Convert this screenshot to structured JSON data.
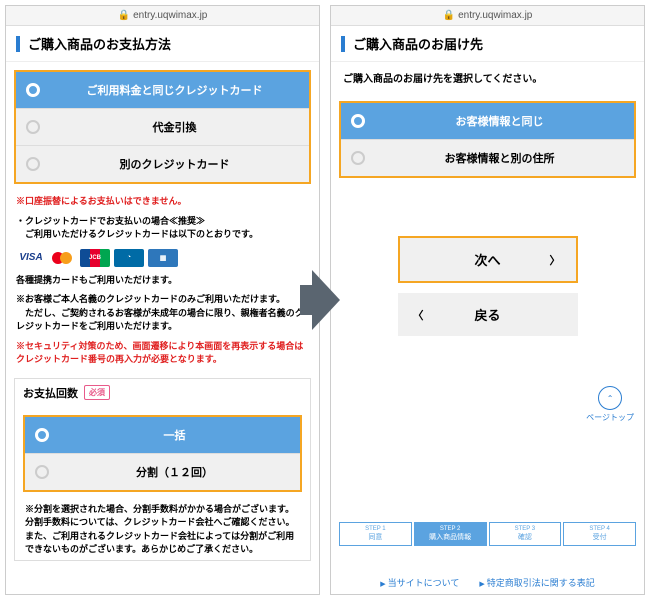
{
  "url": "entry.uqwimax.jp",
  "left": {
    "title": "ご購入商品のお支払方法",
    "payment_options": [
      {
        "label": "ご利用料金と同じクレジットカード",
        "selected": true
      },
      {
        "label": "代金引換",
        "selected": false
      },
      {
        "label": "別のクレジットカード",
        "selected": false
      }
    ],
    "warn1": "※口座振替によるお支払いはできません。",
    "cc_intro1": "・クレジットカードでお支払いの場合≪推奨≫",
    "cc_intro2": "　ご利用いただけるクレジットカードは以下のとおりです。",
    "note1": "各種提携カードもご利用いただけます。",
    "note2": "※お客様ご本人名義のクレジットカードのみご利用いただけます。",
    "note3": "　ただし、ご契約されるお客様が未成年の場合に限り、親権者名義のクレジットカードをご利用いただけます。",
    "warn2": "※セキュリティ対策のため、画面遷移により本画面を再表示する場合はクレジットカード番号の再入力が必要となります。",
    "installment_title": "お支払回数",
    "required": "必須",
    "installment_options": [
      {
        "label": "一括",
        "selected": true
      },
      {
        "label": "分割（１２回）",
        "selected": false
      }
    ],
    "install_note": "※分割を選択された場合、分割手数料がかかる場合がございます。分割手数料については、クレジットカード会社へご確認ください。また、ご利用されるクレジットカード会社によっては分割がご利用できないものがございます。あらかじめご了承ください。"
  },
  "right": {
    "title": "ご購入商品のお届け先",
    "instruction": "ご購入商品のお届け先を選択してください。",
    "delivery_options": [
      {
        "label": "お客様情報と同じ",
        "selected": true
      },
      {
        "label": "お客様情報と別の住所",
        "selected": false
      }
    ],
    "next": "次へ",
    "back": "戻る",
    "page_top": "ページトップ",
    "steps": [
      {
        "no": "STEP 1",
        "label": "同意"
      },
      {
        "no": "STEP 2",
        "label": "購入商品情報"
      },
      {
        "no": "STEP 3",
        "label": "確認"
      },
      {
        "no": "STEP 4",
        "label": "受付"
      }
    ],
    "footer1": "当サイトについて",
    "footer2": "特定商取引法に関する表記"
  }
}
